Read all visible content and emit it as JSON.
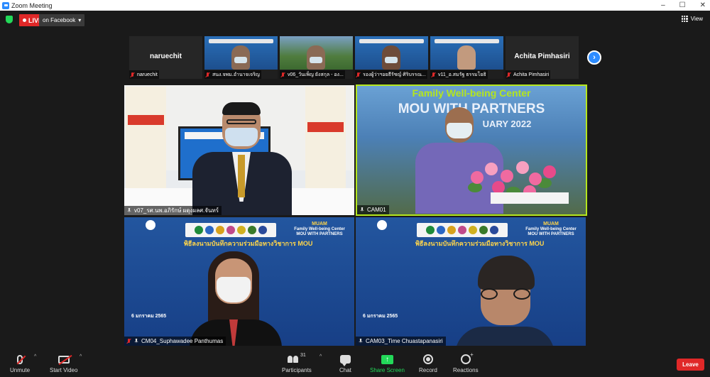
{
  "window": {
    "title": "Zoom Meeting",
    "controls": [
      "–",
      "☐",
      "✕"
    ]
  },
  "topbar": {
    "live_label": "LIVE",
    "stream_target": "on Facebook",
    "view_label": "View"
  },
  "gallery_strip": [
    {
      "name": "naruechit",
      "display": "naruechit",
      "kind": "name-card"
    },
    {
      "name": "สนง.จพม.อำนาจเจริญ",
      "kind": "poster"
    },
    {
      "name": "v06_วันเพ็ญ ยังสกุล - อง...",
      "kind": "forest"
    },
    {
      "name": "รองผู้ว่าฯอยธีรัชญ์ ศิริบรรณ...",
      "kind": "poster"
    },
    {
      "name": "v11_อ.สมรัฐ ธรรมโยธิ",
      "kind": "poster"
    },
    {
      "name": "Achita Pimhasiri",
      "display": "Achita Pimhasiri",
      "kind": "name-card"
    }
  ],
  "tiles": [
    {
      "name": "v07_รศ.นพ.อภิรักษ์ ผดุงผลศ.จันทร์"
    },
    {
      "name": "CAM01",
      "banner_line1": "Family Well-being Center",
      "banner_line2": "MOU WITH PARTNERS",
      "banner_line3": "UARY 2022"
    },
    {
      "name": "CM04_Suphawadee Panthumas"
    },
    {
      "name": "CAM03_Time Chuastapanasiri"
    }
  ],
  "poster": {
    "thai_title": "พิธีลงนามบันทึกความร่วมมือทางวิชาการ MOU",
    "date": "6 มกราคม 2565",
    "mj_label": "MUAM",
    "mj_line1": "Family Well-being Center",
    "mj_line2": "MOU WITH PARTNERS"
  },
  "controls": {
    "unmute": "Unmute",
    "start_video": "Start Video",
    "participants": "Participants",
    "participant_count": "31",
    "chat": "Chat",
    "share_screen": "Share Screen",
    "record": "Record",
    "reactions": "Reactions",
    "leave": "Leave"
  },
  "colors": {
    "accent": "#2d8cff",
    "live": "#e02828",
    "share": "#23d959",
    "active_border": "#b5e61d"
  }
}
